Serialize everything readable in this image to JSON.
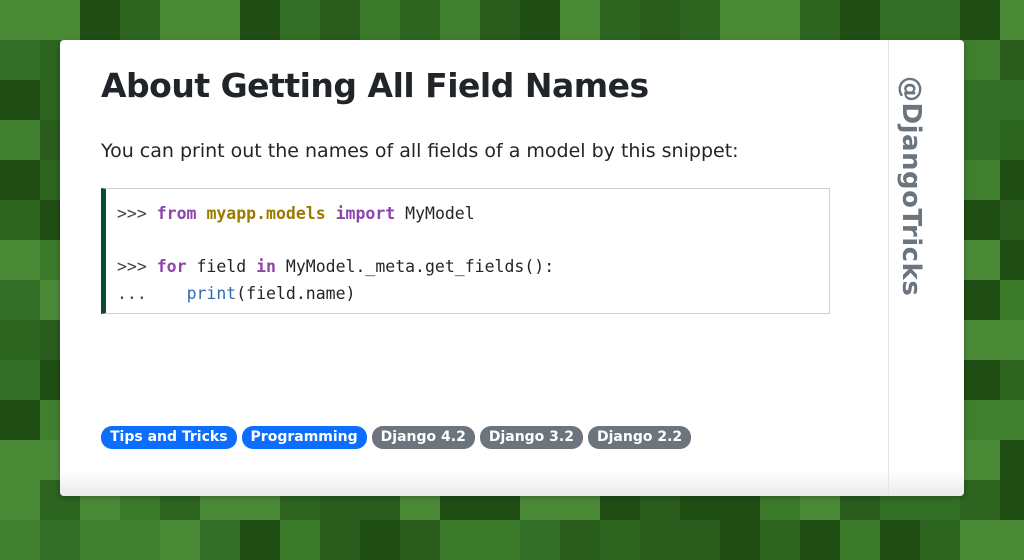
{
  "background": {
    "colors": [
      "#1f4d14",
      "#2c6420",
      "#3a7a2a",
      "#4a8a37",
      "#2a5c1d",
      "#407f30",
      "#336f26"
    ]
  },
  "card": {
    "title": "About Getting All Field Names",
    "intro": "You can print out the names of all fields of a model by this snippet:",
    "handle": "@DjangoTricks",
    "accent_color": "#0c4b33"
  },
  "code": {
    "line1": {
      "prompt": ">>> ",
      "kw1": "from",
      "module": "myapp.models",
      "kw2": "import",
      "name": "MyModel"
    },
    "line2": {
      "prompt": ">>> ",
      "kw1": "for",
      "var": "field",
      "kw2": "in",
      "expr": "MyModel._meta.get_fields():"
    },
    "line3": {
      "prompt": "...",
      "indent": "    ",
      "fn": "print",
      "args": "(field.name)"
    }
  },
  "tags": [
    {
      "label": "Tips and Tricks",
      "color": "#0d6efd"
    },
    {
      "label": "Programming",
      "color": "#0d6efd"
    },
    {
      "label": "Django 4.2",
      "color": "#6c757d"
    },
    {
      "label": "Django 3.2",
      "color": "#6c757d"
    },
    {
      "label": "Django 2.2",
      "color": "#6c757d"
    }
  ]
}
